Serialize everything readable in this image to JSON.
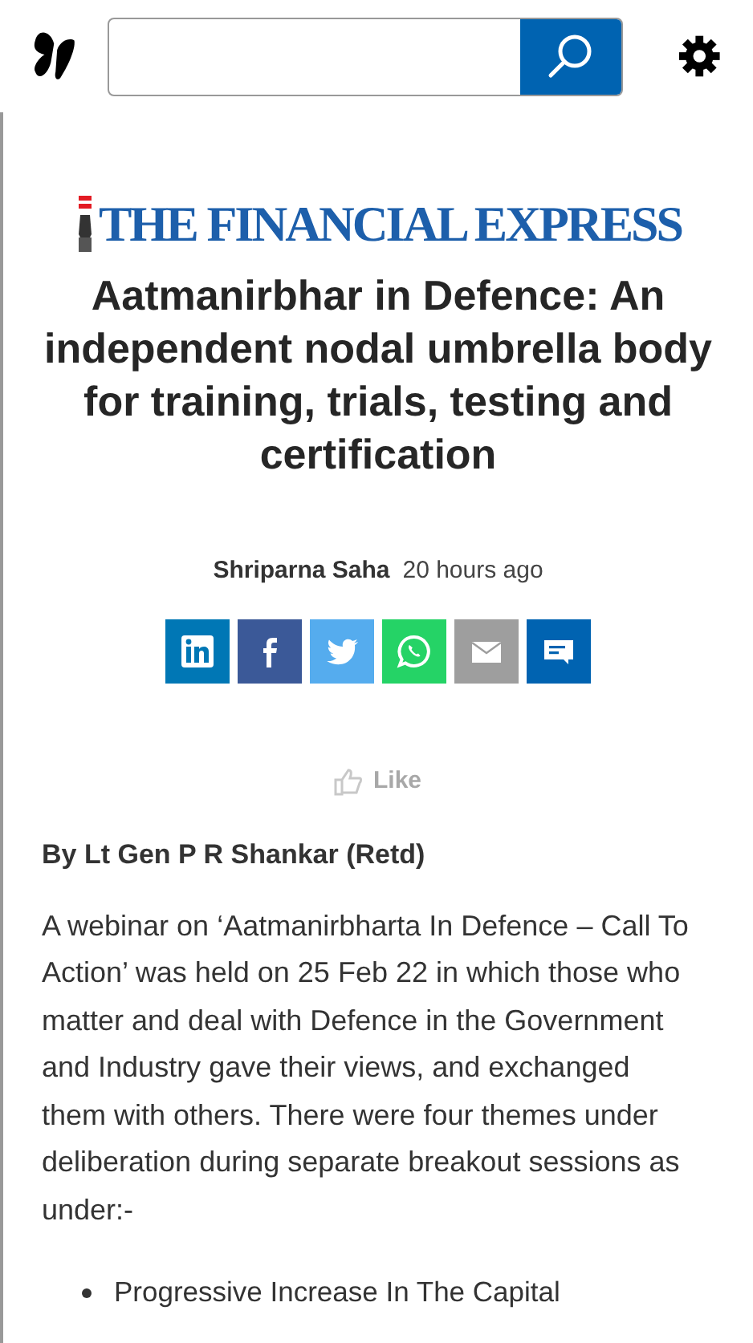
{
  "article": {
    "publisher": "THE FINANCIAL EXPRESS",
    "title": "Aatmanirbhar in Defence: An independent nodal umbrella body for training, trials, testing and certification",
    "author": "Shriparna Saha",
    "time": "20 hours ago",
    "share": [
      {
        "kind": "linkedin"
      },
      {
        "kind": "facebook"
      },
      {
        "kind": "twitter"
      },
      {
        "kind": "whatsapp"
      },
      {
        "kind": "email"
      },
      {
        "kind": "comment"
      }
    ],
    "like": {
      "label": "Like"
    },
    "byline": "By Lt Gen P R Shankar (Retd)",
    "paragraphs": [
      "A webinar on ‘Aatmanirbharta In Defence – Call To Action’ was held on 25 Feb 22 in which those who matter and deal with Defence in the Government and Industry gave their views, and exchanged them with others. There were four themes under deliberation during separate breakout sessions as under:-"
    ],
    "bullets": [
      "Progressive Increase In The Capital"
    ]
  }
}
